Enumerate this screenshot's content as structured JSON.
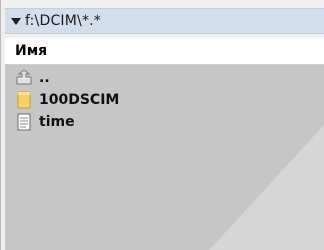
{
  "path_bar": {
    "path": "f:\\DCIM\\*.*"
  },
  "columns": {
    "name": "Имя"
  },
  "items": [
    {
      "label": "..",
      "icon": "up-folder-icon"
    },
    {
      "label": "100DSCIM",
      "icon": "folder-icon"
    },
    {
      "label": "time",
      "icon": "file-icon"
    }
  ],
  "colors": {
    "path_bar": "#d3deeb",
    "list_bg": "#c6c6c6",
    "folder": "#f4d35e"
  }
}
